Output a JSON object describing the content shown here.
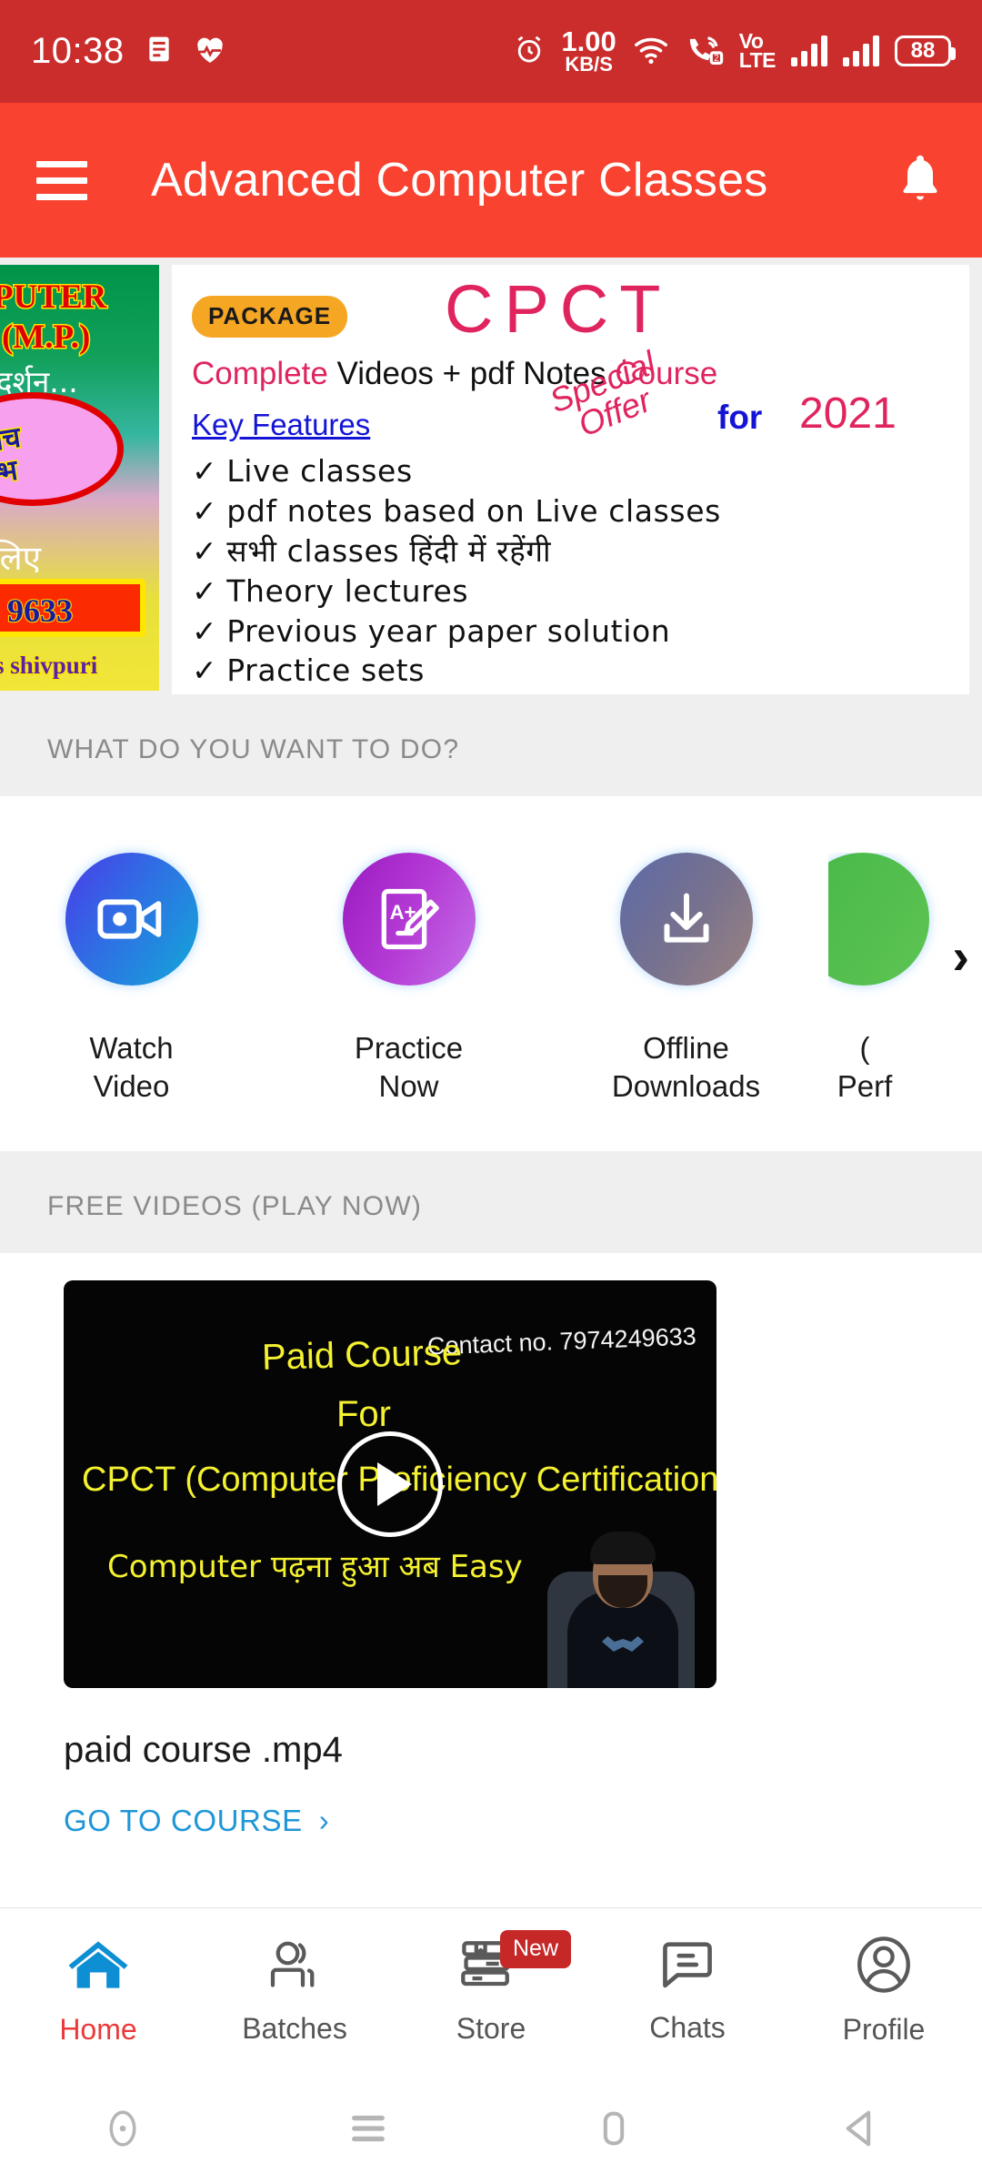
{
  "status_bar": {
    "time": "10:38",
    "net_speed_value": "1.00",
    "net_speed_unit": "KB/S",
    "sim_badge": "2",
    "volte_top": "Vo",
    "volte_bottom": "LTE",
    "battery": "88",
    "icons": [
      "document-icon",
      "heart-health-icon",
      "alarm-icon",
      "wifi-icon",
      "call-wifi-icon",
      "volte-icon",
      "signal-icon",
      "signal-icon",
      "battery-icon"
    ]
  },
  "app_bar": {
    "title": "Advanced Computer Classes",
    "menu_icon": "hamburger-menu-icon",
    "notification_icon": "bell-icon",
    "background": "#f9422f"
  },
  "banner": {
    "ad_left": {
      "line1": "PUTER",
      "line2": "(M.P.)",
      "line3": "दर्शन...",
      "oval_line1": "बीच",
      "oval_line2": "ारम्भ",
      "line4": "लिए",
      "phone": "9633",
      "footer": "es shivpuri"
    },
    "cpct": {
      "package_badge": "PACKAGE",
      "title": "CPCT",
      "subtitle_pink_1": "Complete",
      "subtitle_black": "Videos + pdf Notes",
      "subtitle_pink_2": "Course",
      "key_features_label": "Key Features",
      "special_offer_line1": "Special",
      "special_offer_line2": "Offer",
      "for_label": "for",
      "year": "2021",
      "features": [
        "Live classes",
        "pdf notes based on Live classes",
        "सभी classes हिंदी में रहेंगी",
        "Theory lectures",
        "Previous year paper solution",
        "Practice sets"
      ],
      "check_mark": "✓"
    }
  },
  "sections": {
    "actions_header": "WHAT DO YOU WANT TO DO?",
    "free_videos_header": "FREE VIDEOS (PLAY NOW)"
  },
  "actions": {
    "items": [
      {
        "label_line1": "Watch",
        "label_line2": "Video",
        "icon": "video-camera-icon"
      },
      {
        "label_line1": "Practice",
        "label_line2": "Now",
        "icon": "a-plus-pencil-icon"
      },
      {
        "label_line1": "Offline",
        "label_line2": "Downloads",
        "icon": "download-icon"
      },
      {
        "label_line1": "(",
        "label_line2": "Perf",
        "icon": "performance-icon"
      }
    ],
    "next_arrow": "›"
  },
  "free_video": {
    "thumbnail": {
      "contact": "Contact no. 7974249633",
      "line1": "Paid Course",
      "line2": "For",
      "line3": "CPCT (Computer Proficiency Certification test)",
      "line4": "Computer पढ़ना हुआ अब Easy",
      "play_icon": "play-icon"
    },
    "title": "paid course .mp4",
    "cta": "GO TO COURSE",
    "cta_chevron": "›"
  },
  "bottom_nav": {
    "items": [
      {
        "label": "Home",
        "icon": "home-icon",
        "active": true,
        "badge": ""
      },
      {
        "label": "Batches",
        "icon": "people-icon",
        "active": false,
        "badge": ""
      },
      {
        "label": "Store",
        "icon": "books-icon",
        "active": false,
        "badge": "New"
      },
      {
        "label": "Chats",
        "icon": "chat-icon",
        "active": false,
        "badge": ""
      },
      {
        "label": "Profile",
        "icon": "profile-icon",
        "active": false,
        "badge": ""
      }
    ],
    "active_color": "#ea3a3a",
    "active_icon_color": "#0e8fd4"
  },
  "system_nav": {
    "icons": [
      "recent-dot-icon",
      "menu-lines-icon",
      "home-square-icon",
      "back-triangle-icon"
    ]
  }
}
